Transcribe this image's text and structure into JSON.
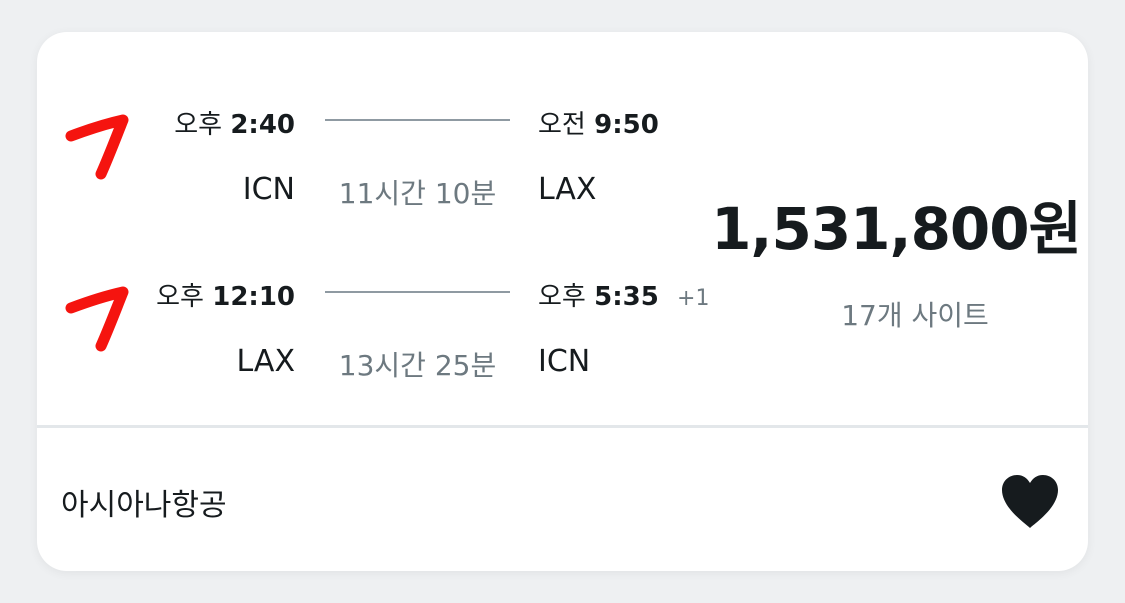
{
  "outbound": {
    "dep_ampm": "오후",
    "dep_time": "2:40",
    "arr_ampm": "오전",
    "arr_time": "9:50",
    "arr_day_offset": "",
    "from": "ICN",
    "to": "LAX",
    "duration": "11시간 10분",
    "logo_icon": "airline-logo-icon"
  },
  "inbound": {
    "dep_ampm": "오후",
    "dep_time": "12:10",
    "arr_ampm": "오후",
    "arr_time": "5:35",
    "arr_day_offset": "+1",
    "from": "LAX",
    "to": "ICN",
    "duration": "13시간 25분",
    "logo_icon": "airline-logo-icon"
  },
  "price": {
    "amount": "1,531,800원",
    "sites": "17개 사이트"
  },
  "footer": {
    "airline": "아시아나항공",
    "favorite_icon": "heart-icon"
  },
  "colors": {
    "logo_red": "#f5140f",
    "text_primary": "#161b1e",
    "text_secondary": "#6d7980",
    "line": "#8f9aa2"
  }
}
